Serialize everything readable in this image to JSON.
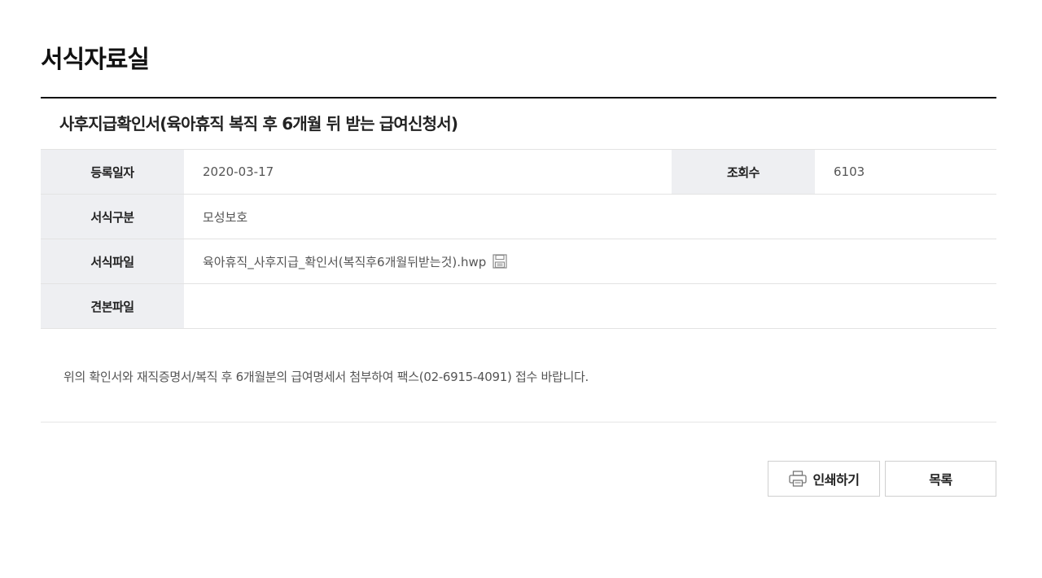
{
  "page": {
    "title": "서식자료실"
  },
  "post": {
    "title": "사후지급확인서(육아휴직 복직 후 6개월 뒤 받는 급여신청서)",
    "fields": {
      "reg_date_label": "등록일자",
      "reg_date_value": "2020-03-17",
      "views_label": "조회수",
      "views_value": "6103",
      "category_label": "서식구분",
      "category_value": "모성보호",
      "file_label": "서식파일",
      "file_value": "육아휴직_사후지급_확인서(복직후6개월뒤받는것).hwp",
      "sample_label": "견본파일",
      "sample_value": ""
    },
    "content": "위의 확인서와 재직증명서/복직 후 6개월분의 급여명세서 첨부하여 팩스(02-6915-4091) 접수 바랍니다."
  },
  "buttons": {
    "print_label": "인쇄하기",
    "list_label": "목록"
  },
  "icons": {
    "save": "save-icon",
    "print": "printer-icon"
  }
}
